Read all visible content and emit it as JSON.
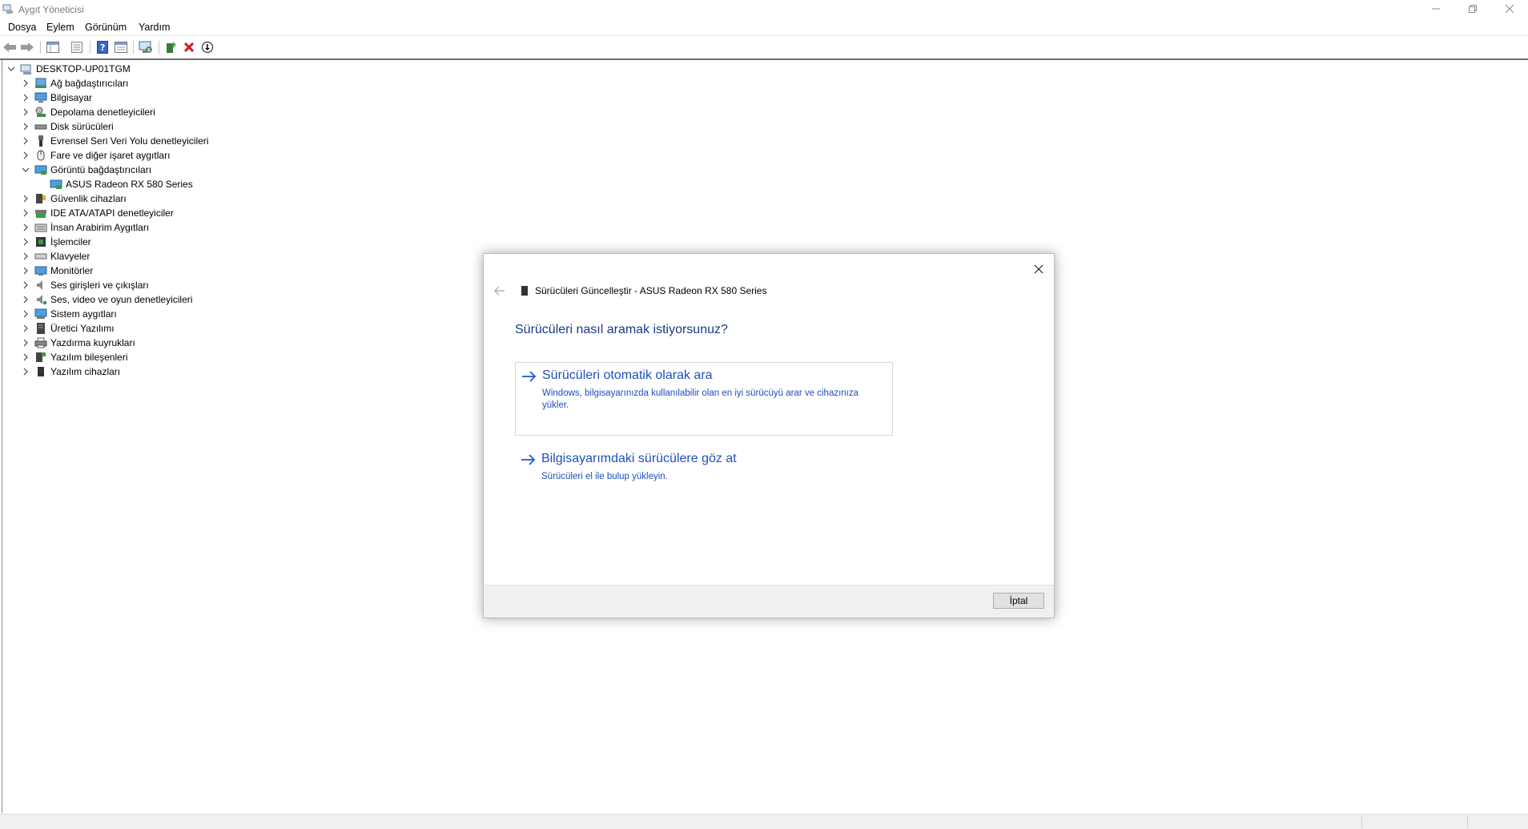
{
  "window": {
    "title": "Aygıt Yöneticisi"
  },
  "menu": [
    "Dosya",
    "Eylem",
    "Görünüm",
    "Yardım"
  ],
  "toolbar": {
    "buttons": [
      "back-arrow-icon",
      "forward-arrow-icon",
      "properties-view-icon",
      "show-hide-console-tree-icon",
      "help-icon",
      "view-list-icon",
      "scan-hardware-icon",
      "enable-device-icon",
      "uninstall-device-icon",
      "update-driver-icon"
    ]
  },
  "tree": {
    "root": "DESKTOP-UP01TGM",
    "categories": [
      {
        "label": "Ağ bağdaştırıcıları",
        "icon": "network-adapter-icon",
        "expanded": false
      },
      {
        "label": "Bilgisayar",
        "icon": "computer-icon",
        "expanded": false
      },
      {
        "label": "Depolama denetleyicileri",
        "icon": "storage-controller-icon",
        "expanded": false
      },
      {
        "label": "Disk sürücüleri",
        "icon": "disk-drive-icon",
        "expanded": false
      },
      {
        "label": "Evrensel Seri Veri Yolu denetleyicileri",
        "icon": "usb-icon",
        "expanded": false
      },
      {
        "label": "Fare ve diğer işaret aygıtları",
        "icon": "mouse-icon",
        "expanded": false
      },
      {
        "label": "Görüntü bağdaştırıcıları",
        "icon": "display-adapter-icon",
        "expanded": true
      },
      {
        "label": "ASUS Radeon RX 580 Series",
        "icon": "display-adapter-icon",
        "child": true
      },
      {
        "label": "Güvenlik cihazları",
        "icon": "security-device-icon",
        "expanded": false
      },
      {
        "label": "IDE ATA/ATAPI denetleyiciler",
        "icon": "ide-controller-icon",
        "expanded": false
      },
      {
        "label": "İnsan Arabirim Aygıtları",
        "icon": "hid-icon",
        "expanded": false
      },
      {
        "label": "İşlemciler",
        "icon": "processor-icon",
        "expanded": false
      },
      {
        "label": "Klavyeler",
        "icon": "keyboard-icon",
        "expanded": false
      },
      {
        "label": "Monitörler",
        "icon": "monitor-icon",
        "expanded": false
      },
      {
        "label": "Ses girişleri ve çıkışları",
        "icon": "audio-io-icon",
        "expanded": false
      },
      {
        "label": "Ses, video ve oyun denetleyicileri",
        "icon": "sound-video-icon",
        "expanded": false
      },
      {
        "label": "Sistem aygıtları",
        "icon": "system-device-icon",
        "expanded": false
      },
      {
        "label": "Üretici Yazılımı",
        "icon": "firmware-icon",
        "expanded": false
      },
      {
        "label": "Yazdırma kuyrukları",
        "icon": "printer-icon",
        "expanded": false
      },
      {
        "label": "Yazılım bileşenleri",
        "icon": "software-component-icon",
        "expanded": false
      },
      {
        "label": "Yazılım cihazları",
        "icon": "software-device-icon",
        "expanded": false
      }
    ]
  },
  "dialog": {
    "title": "Sürücüleri Güncelleştir - ASUS Radeon RX 580 Series",
    "question": "Sürücüleri nasıl aramak istiyorsunuz?",
    "option_auto": {
      "title": "Sürücüleri otomatik olarak ara",
      "desc": "Windows, bilgisayarınızda kullanılabilir olan en iyi sürücüyü arar ve cihazınıza yükler."
    },
    "option_browse": {
      "title": "Bilgisayarımdaki sürücülere göz at",
      "desc": "Sürücüleri el ile bulup yükleyin."
    },
    "cancel_label": "İptal"
  },
  "colors": {
    "link": "#1f4fbf",
    "heading": "#1a3a8a",
    "accent_arrow": "#2458d6"
  }
}
